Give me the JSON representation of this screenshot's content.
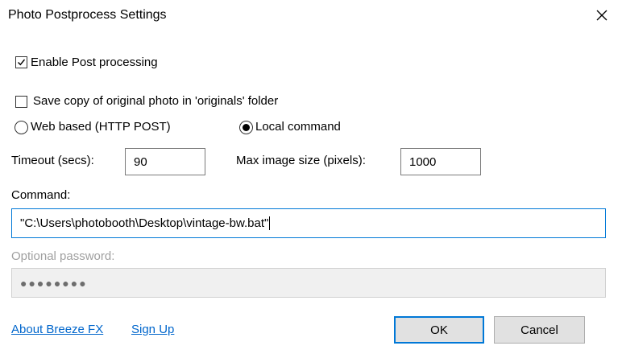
{
  "dialog": {
    "title": "Photo Postprocess Settings",
    "close_icon": "close-icon"
  },
  "options": {
    "enable_post_processing": {
      "label": "Enable Post processing",
      "checked": true
    },
    "save_original_copy": {
      "label": "Save copy of original photo in 'originals' folder",
      "checked": false
    },
    "mode": {
      "web_based": {
        "label": "Web based (HTTP POST)",
        "selected": false
      },
      "local_command": {
        "label": "Local command",
        "selected": true
      }
    }
  },
  "timeout": {
    "label": "Timeout (secs):",
    "value": "90"
  },
  "max_image_size": {
    "label": "Max image size (pixels):",
    "value": "1000"
  },
  "command": {
    "label": "Command:",
    "value": "\"C:\\Users\\photobooth\\Desktop\\vintage-bw.bat\""
  },
  "password": {
    "label": "Optional password:",
    "value": "●●●●●●●●"
  },
  "links": {
    "about": "About Breeze FX",
    "signup": "Sign Up"
  },
  "buttons": {
    "ok": "OK",
    "cancel": "Cancel"
  },
  "colors": {
    "accent": "#0078d7",
    "link": "#0066cc",
    "button_face": "#e1e1e1",
    "disabled_field": "#f0f0f0"
  }
}
